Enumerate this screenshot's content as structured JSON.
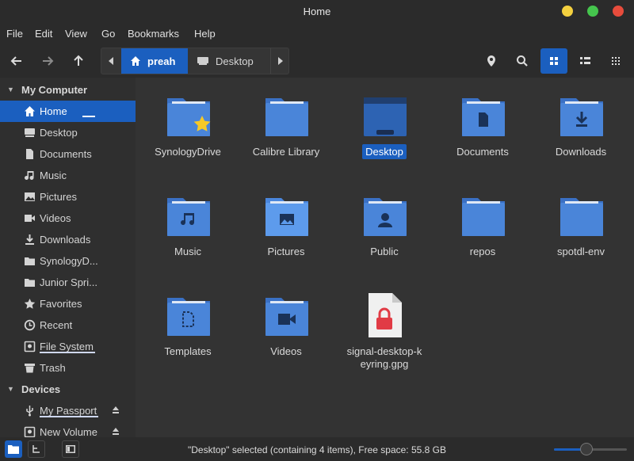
{
  "window": {
    "title": "Home",
    "buttons": {
      "minimize_color": "#f4d03f",
      "maximize_color": "#45c54d",
      "close_color": "#e74c3c"
    }
  },
  "menu": [
    "File",
    "Edit",
    "View",
    "Go",
    "Bookmarks",
    "Help"
  ],
  "toolbar": {
    "back_icon": "arrow-left-icon",
    "forward_icon": "arrow-right-icon",
    "up_icon": "arrow-up-icon",
    "breadcrumbs": [
      "preah",
      "Desktop"
    ],
    "location_icon": "map-pin-icon",
    "search_icon": "search-icon",
    "icon_view_icon": "grid-icon",
    "list_view_icon": "list-icon",
    "compact_view_icon": "compact-grid-icon"
  },
  "sidebar": {
    "sections": [
      {
        "title": "My Computer",
        "items": [
          {
            "label": "Home",
            "icon": "home-icon",
            "active": true
          },
          {
            "label": "Desktop",
            "icon": "desktop-icon"
          },
          {
            "label": "Documents",
            "icon": "document-icon"
          },
          {
            "label": "Music",
            "icon": "music-icon"
          },
          {
            "label": "Pictures",
            "icon": "picture-icon"
          },
          {
            "label": "Videos",
            "icon": "video-icon"
          },
          {
            "label": "Downloads",
            "icon": "download-icon"
          },
          {
            "label": "SynologyD...",
            "icon": "folder-icon"
          },
          {
            "label": "Junior Spri...",
            "icon": "folder-icon"
          },
          {
            "label": "Favorites",
            "icon": "star-icon"
          },
          {
            "label": "Recent",
            "icon": "clock-icon"
          },
          {
            "label": "File System",
            "icon": "drive-icon"
          },
          {
            "label": "Trash",
            "icon": "trash-icon"
          }
        ]
      },
      {
        "title": "Devices",
        "items": [
          {
            "label": "My Passport",
            "icon": "usb-icon",
            "eject": true
          },
          {
            "label": "New Volume",
            "icon": "drive-icon",
            "eject": true
          }
        ]
      }
    ]
  },
  "files": [
    {
      "name": "SynologyDrive",
      "icon": "folder-star-icon"
    },
    {
      "name": "Calibre Library",
      "icon": "folder-icon"
    },
    {
      "name": "Desktop",
      "icon": "folder-desktop-icon",
      "selected": true
    },
    {
      "name": "Documents",
      "icon": "folder-documents-icon"
    },
    {
      "name": "Downloads",
      "icon": "folder-downloads-icon"
    },
    {
      "name": "Music",
      "icon": "folder-music-icon"
    },
    {
      "name": "Pictures",
      "icon": "folder-pictures-icon"
    },
    {
      "name": "Public",
      "icon": "folder-public-icon"
    },
    {
      "name": "repos",
      "icon": "folder-icon"
    },
    {
      "name": "spotdl-env",
      "icon": "folder-icon"
    },
    {
      "name": "Templates",
      "icon": "folder-templates-icon"
    },
    {
      "name": "Videos",
      "icon": "folder-videos-icon"
    },
    {
      "name": "signal-desktop-keyring.gpg",
      "icon": "locked-file-icon"
    }
  ],
  "statusbar": {
    "text": "\"Desktop\" selected (containing 4 items), Free space: 55.8 GB",
    "zoom_level": 0.45,
    "places_icon": "folder-icon",
    "tree_icon": "tree-icon",
    "hide_sidebar_icon": "sidebar-toggle-icon"
  },
  "colors": {
    "accent": "#1b5fbf",
    "folder": "#4a85d9",
    "folder_light": "#5d9bec"
  }
}
